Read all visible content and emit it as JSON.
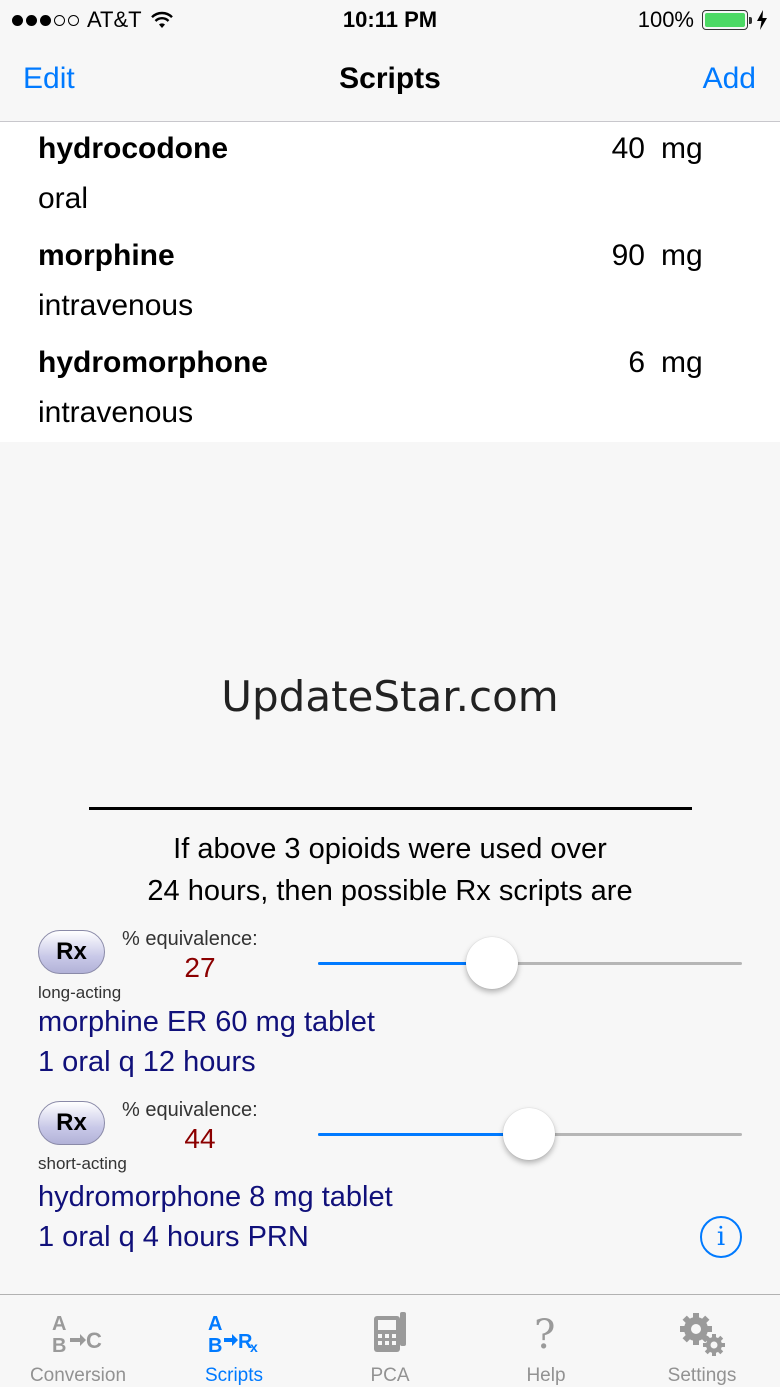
{
  "status_bar": {
    "carrier": "AT&T",
    "time": "10:11 PM",
    "battery": "100%"
  },
  "nav": {
    "edit_label": "Edit",
    "title": "Scripts",
    "add_label": "Add"
  },
  "drugs": [
    {
      "name": "hydrocodone",
      "route": "oral",
      "dose": "40",
      "unit": "mg"
    },
    {
      "name": "morphine",
      "route": "intravenous",
      "dose": "90",
      "unit": "mg"
    },
    {
      "name": "hydromorphone",
      "route": "intravenous",
      "dose": "6",
      "unit": "mg"
    }
  ],
  "ad": {
    "text": "UpdateStar.com"
  },
  "intro": {
    "line1": "If above 3 opioids were used over",
    "line2": "24 hours, then possible Rx scripts are"
  },
  "scripts": [
    {
      "button_label": "Rx",
      "equivalence_label": "% equivalence:",
      "equivalence_value": "27",
      "slider_fraction": 0.41,
      "acting": "long-acting",
      "line1": "morphine ER 60 mg tablet",
      "line2": "1 oral q 12 hours"
    },
    {
      "button_label": "Rx",
      "equivalence_label": "% equivalence:",
      "equivalence_value": "44",
      "slider_fraction": 0.497,
      "acting": "short-acting",
      "line1": "hydromorphone 8 mg tablet",
      "line2": "1 oral q 4 hours PRN"
    }
  ],
  "info": {
    "glyph": "i"
  },
  "tabs": [
    {
      "label": "Conversion",
      "icon": "abc-conversion-icon",
      "active": false
    },
    {
      "label": "Scripts",
      "icon": "ab-rx-icon",
      "active": true
    },
    {
      "label": "PCA",
      "icon": "pca-pump-icon",
      "active": false
    },
    {
      "label": "Help",
      "icon": "question-icon",
      "active": false
    },
    {
      "label": "Settings",
      "icon": "gears-icon",
      "active": false
    }
  ],
  "colors": {
    "accent": "#007aff",
    "equivalence_value": "#8b0000",
    "script_text": "#10107a",
    "slider_fill": "#007aff"
  }
}
